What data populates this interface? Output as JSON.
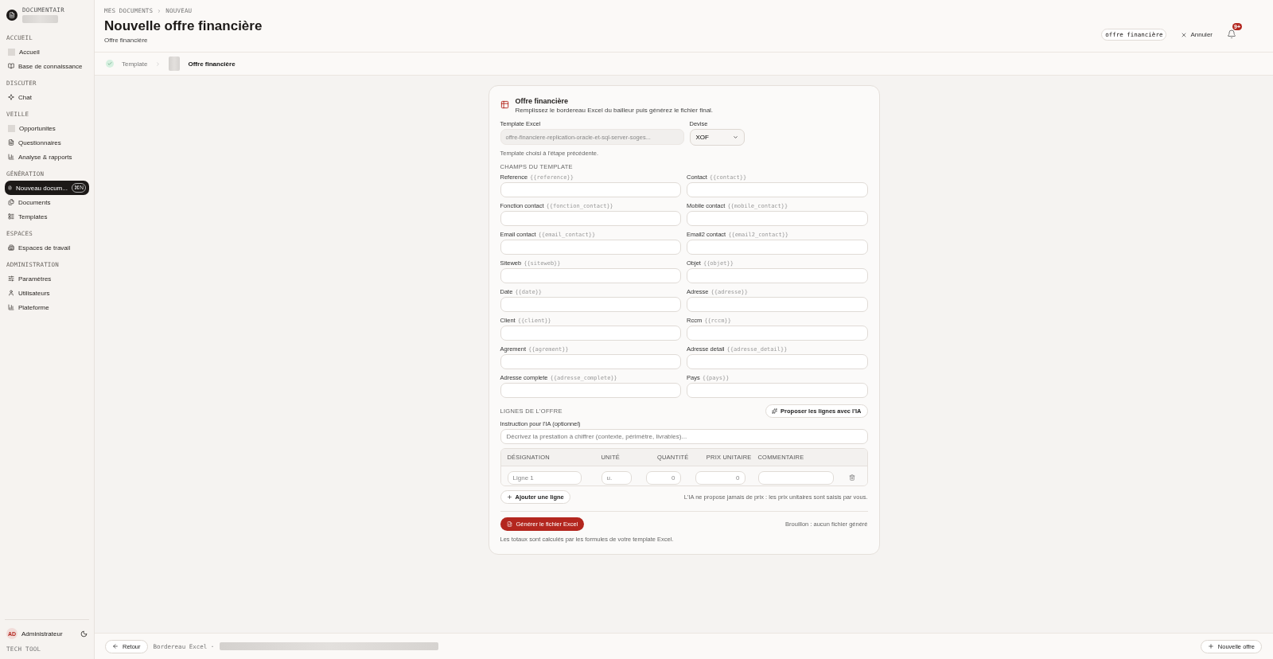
{
  "sidebar": {
    "brand": "DOCUMENTAIR",
    "sections": [
      {
        "title": "ACCUEIL",
        "items": [
          {
            "label": "Accueil",
            "selected": false
          },
          {
            "label": "Base de connaissance",
            "selected": false
          }
        ]
      },
      {
        "title": "DISCUTER",
        "items": [
          {
            "label": "Chat",
            "selected": false
          }
        ]
      },
      {
        "title": "VEILLE",
        "items": [
          {
            "label": "Opportunites",
            "selected": false
          },
          {
            "label": "Questionnaires",
            "selected": false
          },
          {
            "label": "Analyse & rapports",
            "selected": false
          }
        ]
      },
      {
        "title": "GÉNÉRATION",
        "items": [
          {
            "label": "Nouveau docum...",
            "selected": true,
            "shortcut": "⌘N"
          },
          {
            "label": "Documents",
            "selected": false
          },
          {
            "label": "Templates",
            "selected": false
          }
        ]
      },
      {
        "title": "ESPACES",
        "items": [
          {
            "label": "Espaces de travail",
            "selected": false
          }
        ]
      },
      {
        "title": "ADMINISTRATION",
        "items": [
          {
            "label": "Paramètres",
            "selected": false
          },
          {
            "label": "Utilisateurs",
            "selected": false
          },
          {
            "label": "Plateforme",
            "selected": false
          }
        ]
      }
    ],
    "user": {
      "initials": "AD",
      "name": "Administrateur"
    },
    "footer_label": "TECH TOOL"
  },
  "header": {
    "breadcrumb": [
      "MES DOCUMENTS",
      "NOUVEAU"
    ],
    "title": "Nouvelle offre financière",
    "subtitle": "Offre financière",
    "tag": "offre financière",
    "cancel": "Annuler",
    "notifications": "9+"
  },
  "steps": [
    {
      "label": "Template",
      "done": true,
      "selected": false
    },
    {
      "label": "Offre financière",
      "done": false,
      "selected": true
    }
  ],
  "card": {
    "title": "Offre financière",
    "description": "Remplissez le bordereau Excel du bailleur puis générez le fichier final.",
    "template": {
      "label": "Template Excel",
      "value": "offre-financiere-replication-oracle-et-sql-server-soges...",
      "hint": "Template choisi à l'étape précédente."
    },
    "currency": {
      "label": "Devise",
      "value": "XOF"
    },
    "fields_title": "CHAMPS DU TEMPLATE",
    "fields": [
      {
        "label": "Reference",
        "token": "{{reference}}"
      },
      {
        "label": "Contact",
        "token": "{{contact}}"
      },
      {
        "label": "Fonction contact",
        "token": "{{fonction_contact}}"
      },
      {
        "label": "Mobile contact",
        "token": "{{mobile_contact}}"
      },
      {
        "label": "Email contact",
        "token": "{{email_contact}}"
      },
      {
        "label": "Email2 contact",
        "token": "{{email2_contact}}"
      },
      {
        "label": "Siteweb",
        "token": "{{siteweb}}"
      },
      {
        "label": "Objet",
        "token": "{{objet}}"
      },
      {
        "label": "Date",
        "token": "{{date}}"
      },
      {
        "label": "Adresse",
        "token": "{{adresse}}"
      },
      {
        "label": "Client",
        "token": "{{client}}"
      },
      {
        "label": "Rccm",
        "token": "{{rccm}}"
      },
      {
        "label": "Agrement",
        "token": "{{agrement}}"
      },
      {
        "label": "Adresse detail",
        "token": "{{adresse_detail}}"
      },
      {
        "label": "Adresse complete",
        "token": "{{adresse_complete}}"
      },
      {
        "label": "Pays",
        "token": "{{pays}}"
      }
    ],
    "lines_title": "LIGNES DE L'OFFRE",
    "ai_button": "Proposer les lignes avec l'IA",
    "instruction": {
      "label": "Instruction pour l'IA (optionnel)",
      "placeholder": "Décrivez la prestation à chiffrer (contexte, périmètre, livrables)..."
    },
    "columns": [
      "DÉSIGNATION",
      "UNITÉ",
      "QUANTITÉ",
      "PRIX UNITAIRE",
      "COMMENTAIRE"
    ],
    "rows": [
      {
        "cells": [
          {
            "placeholder": "Ligne 1"
          },
          {
            "placeholder": "u."
          },
          {
            "placeholder": "0"
          },
          {
            "placeholder": "0"
          }
        ]
      }
    ],
    "add_button": "Ajouter une ligne",
    "note": "L'IA ne propose jamais de prix : les prix unitaires sont saisis par vous.",
    "generate_button": "Générer le fichier Excel",
    "status": "Brouillon : aucun fichier généré",
    "footnote": "Les totaux sont calculés par les formules de votre template Excel."
  },
  "footer": {
    "back": "Retour",
    "crumb": "Bordereau Excel ·",
    "new_offer": "Nouvelle offre"
  }
}
